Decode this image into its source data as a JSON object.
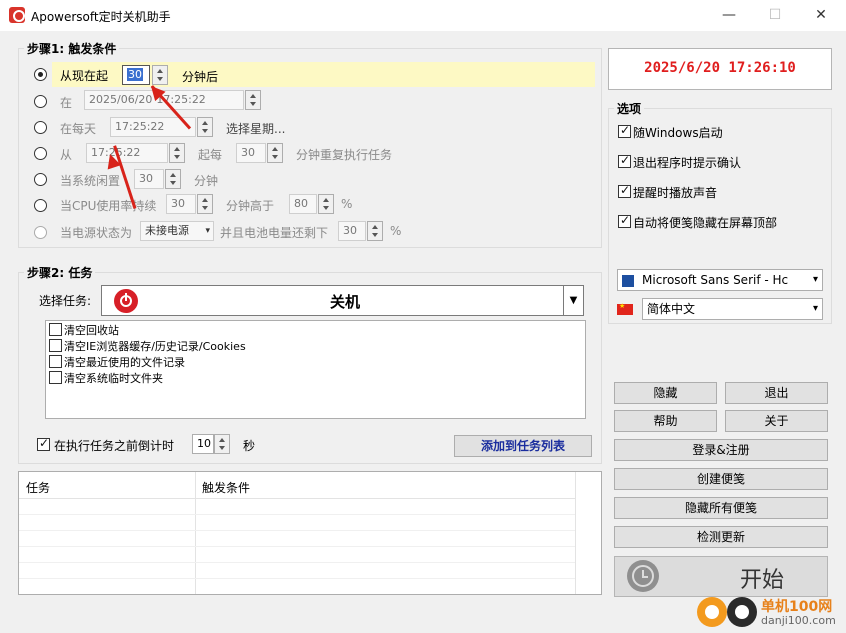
{
  "window": {
    "title": "Apowersoft定时关机助手",
    "minimize": "—",
    "maximize": "☐",
    "close": "✕"
  },
  "step1": {
    "title": "步骤1: 触发条件",
    "from_now_label": "从现在起",
    "from_now_value": "30",
    "from_now_unit": "分钟后",
    "at_label": "在",
    "at_date": "2025/06/20",
    "at_time": "17:25:22",
    "daily_label": "在每天",
    "daily_time": "17:25:22",
    "choose_week": "选择星期...",
    "from_label": "从",
    "from_time": "17:25:22",
    "every_label": "起每",
    "every_value": "30",
    "every_unit": "分钟重复执行任务",
    "idle_label": "当系统闲置",
    "idle_value": "30",
    "idle_unit": "分钟",
    "cpu_label": "当CPU使用率持续",
    "cpu_value": "30",
    "cpu_mid": "分钟高于",
    "cpu_pct": "80",
    "pct": "%",
    "power_label": "当电源状态为",
    "power_value": "未接电源",
    "battery_label": "并且电池电量还剩下",
    "battery_value": "30",
    "pct2": "%"
  },
  "clock": {
    "datetime": "2025/6/20  17:26:10",
    "color": "#e01e1e"
  },
  "options": {
    "title": "选项",
    "items": [
      "随Windows启动",
      "退出程序时提示确认",
      "提醒时播放声音",
      "自动将便笺隐藏在屏幕顶部"
    ],
    "font_value": "Microsoft Sans Serif  - Hc",
    "language_value": "简体中文"
  },
  "step2": {
    "title": "步骤2: 任务",
    "select_label": "选择任务:",
    "task_value": "关机",
    "subtasks": [
      "清空回收站",
      "清空IE浏览器缓存/历史记录/Cookies",
      "清空最近使用的文件记录",
      "清空系统临时文件夹"
    ],
    "countdown_label": "在执行任务之前倒计时",
    "countdown_value": "10",
    "countdown_unit": "秒",
    "add_button": "添加到任务列表"
  },
  "task_table": {
    "columns": [
      "任务",
      "触发条件"
    ]
  },
  "side_buttons": {
    "hide": "隐藏",
    "exit": "退出",
    "help": "帮助",
    "about": "关于",
    "login": "登录&注册",
    "create_note": "创建便笺",
    "hide_notes": "隐藏所有便笺",
    "check_update": "检测更新",
    "start": "开始"
  },
  "watermark": {
    "site": "单机100网",
    "url": "danji100.com"
  },
  "colors": {
    "accent_red": "#d8231a",
    "highlight": "#fdf9c4",
    "add_button_text": "#1a2d9e"
  }
}
